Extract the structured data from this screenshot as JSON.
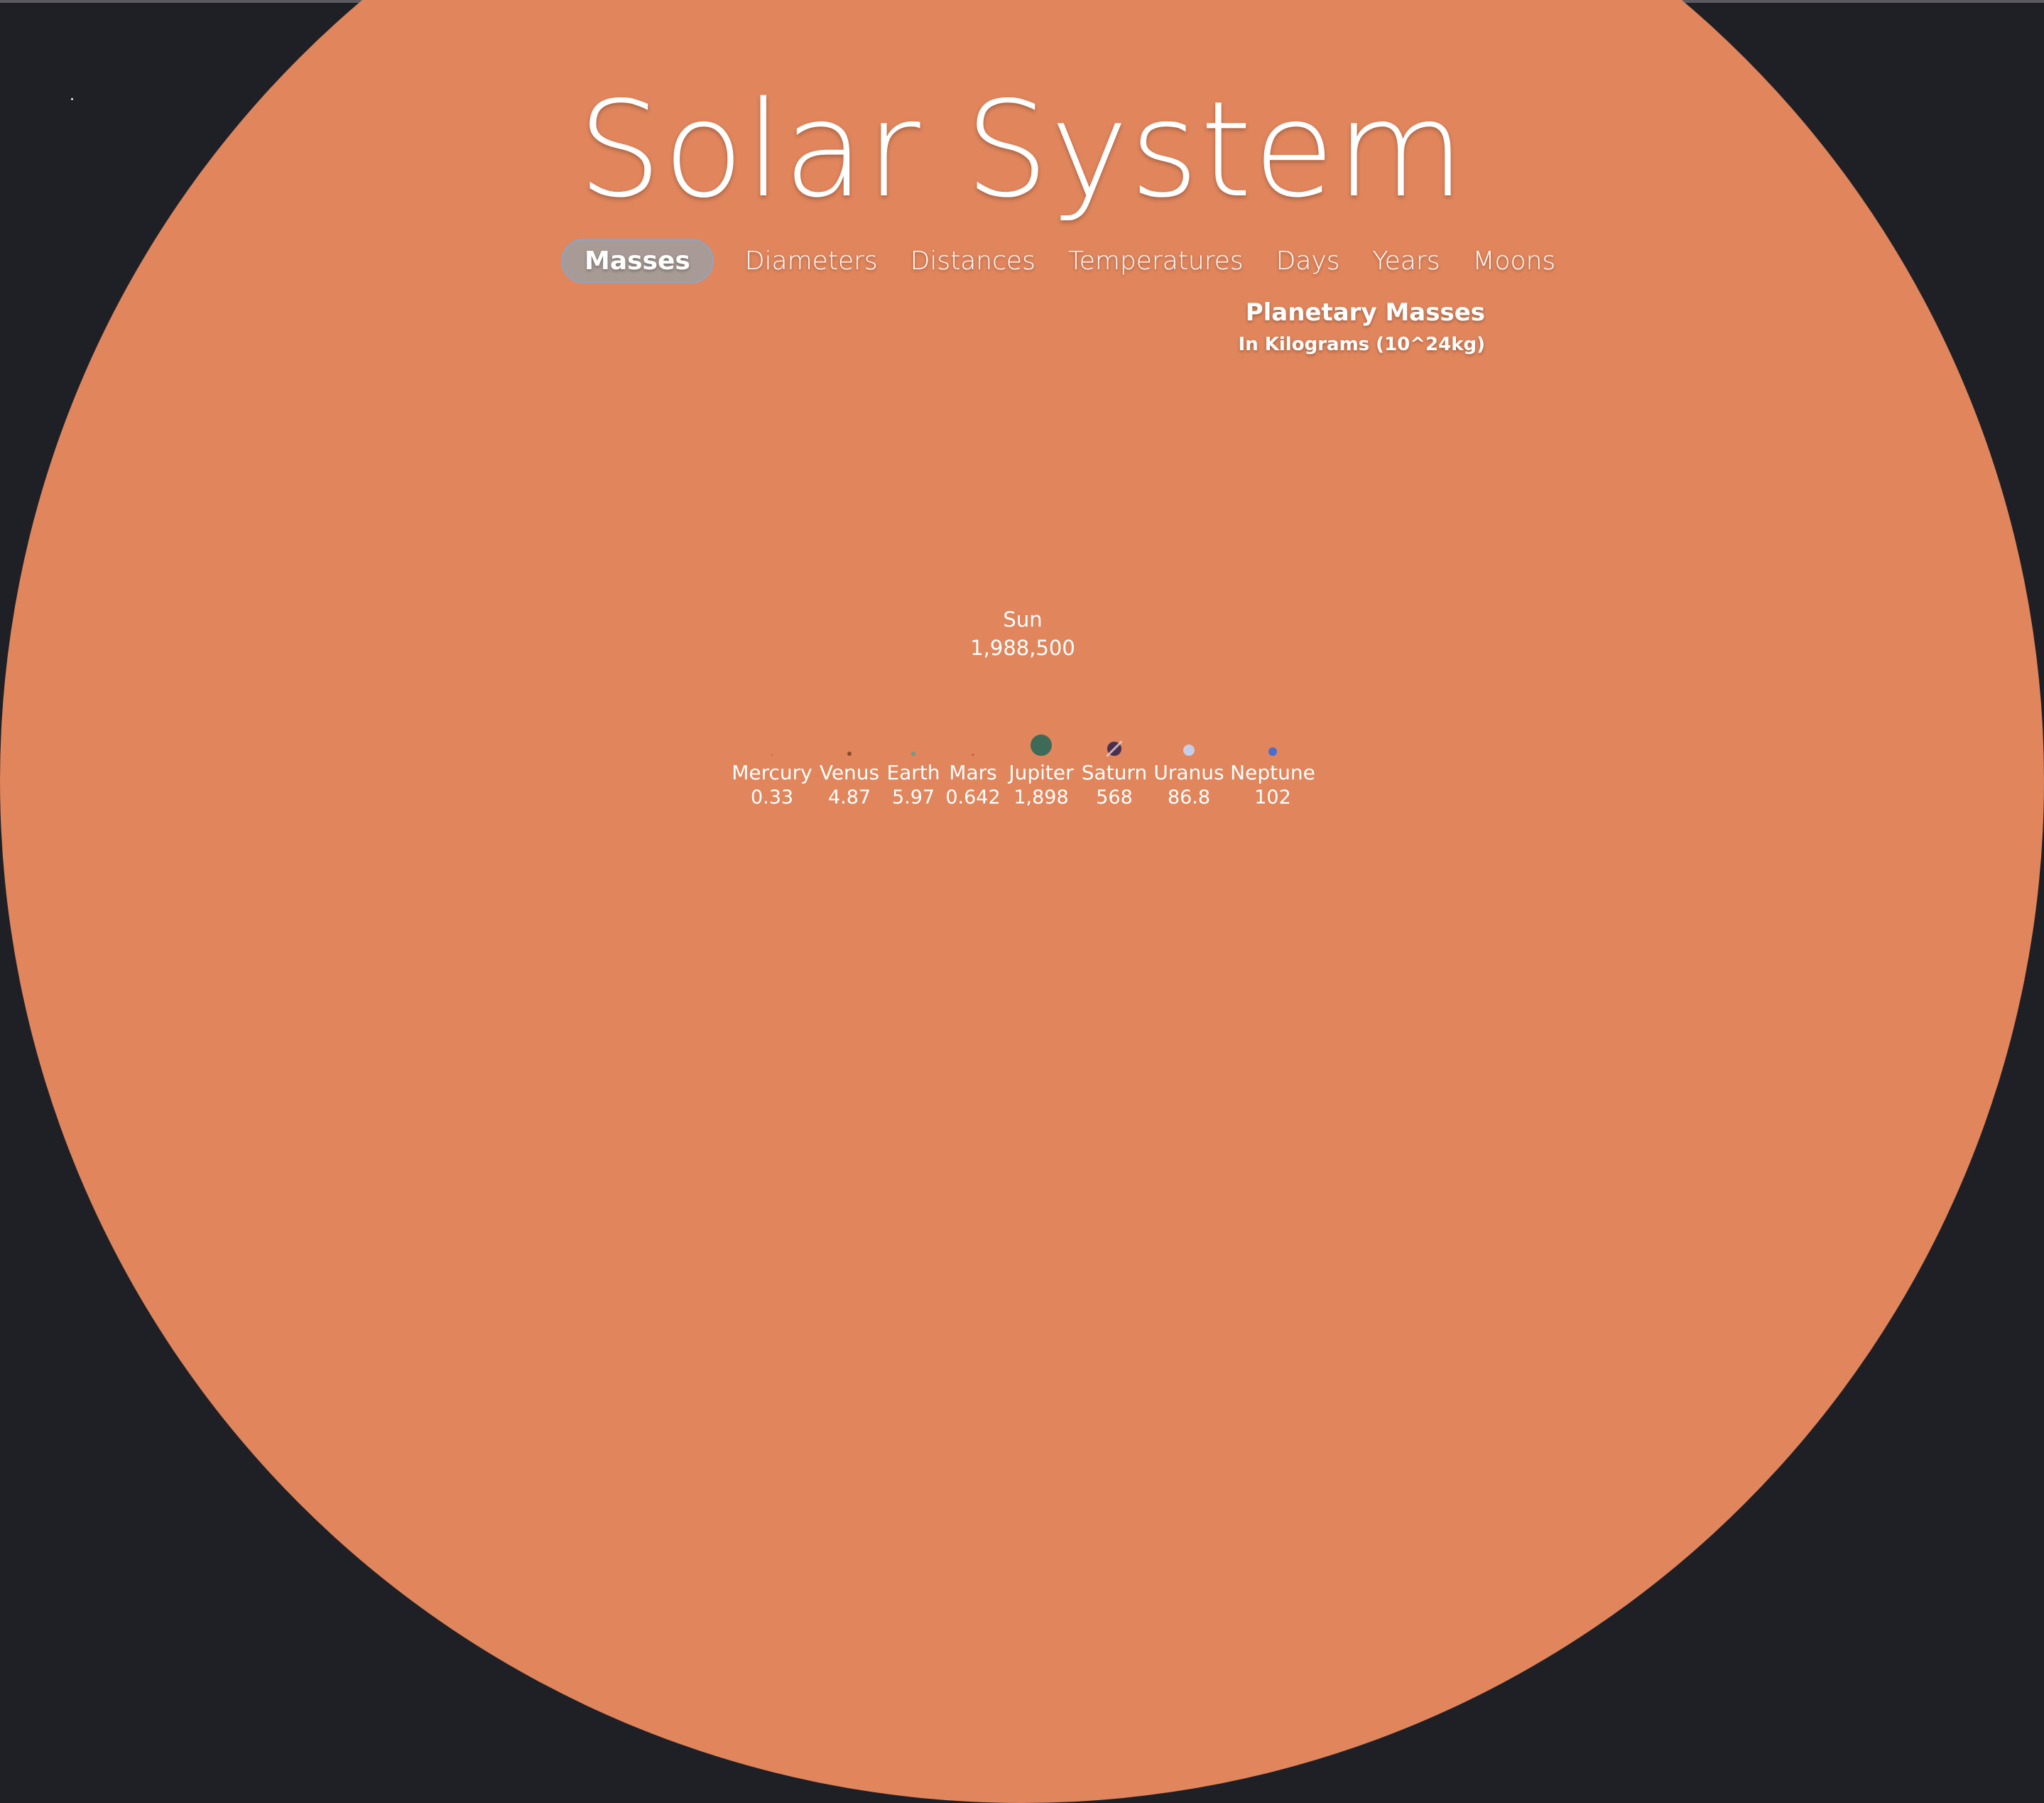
{
  "title": "Solar System",
  "tabs": [
    "Masses",
    "Diameters",
    "Distances",
    "Temperatures",
    "Days",
    "Years",
    "Moons"
  ],
  "active_tab": "Masses",
  "subtitle": {
    "heading": "Planetary Masses",
    "unit": "In Kilograms (10^24kg)"
  },
  "sun": {
    "name": "Sun",
    "value": "1,988,500",
    "color": "#e0855c"
  },
  "planets": [
    {
      "name": "Mercury",
      "value": "0.33",
      "color": "#b5654a"
    },
    {
      "name": "Venus",
      "value": "4.87",
      "color": "#8a4a26"
    },
    {
      "name": "Earth",
      "value": "5.97",
      "color": "#6f9a8a"
    },
    {
      "name": "Mars",
      "value": "0.642",
      "color": "#c0583a"
    },
    {
      "name": "Jupiter",
      "value": "1,898",
      "color": "#3e6b58"
    },
    {
      "name": "Saturn",
      "value": "568",
      "color": "#4a3050"
    },
    {
      "name": "Uranus",
      "value": "86.8",
      "color": "#c6cde6"
    },
    {
      "name": "Neptune",
      "value": "102",
      "color": "#4a6ed0"
    }
  ]
}
